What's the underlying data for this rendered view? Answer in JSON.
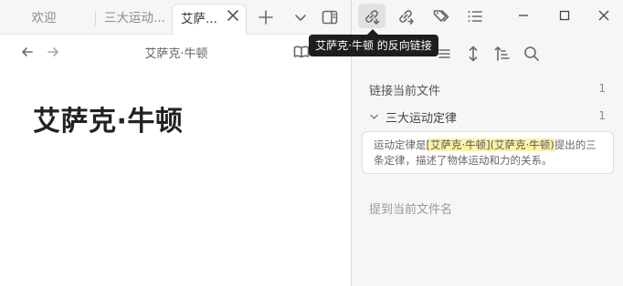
{
  "tabs": [
    {
      "label": "欢迎",
      "active": false
    },
    {
      "label": "三大运动...",
      "active": false
    },
    {
      "label": "艾萨...",
      "active": true
    }
  ],
  "view": {
    "title": "艾萨克·牛顿"
  },
  "document": {
    "title": "艾萨克·牛顿"
  },
  "tooltip": {
    "text": "艾萨克·牛顿 的反向链接"
  },
  "backlinks": {
    "linked_label": "链接当前文件",
    "linked_count": "1",
    "file": {
      "name": "三大运动定律",
      "count": "1"
    },
    "snippet": {
      "prefix": "运动定律是",
      "link1": "[艾萨克·牛顿]",
      "link2": "(艾萨克·牛顿)",
      "suffix": "提出的三条定律，描述了物体运动和力的关系。"
    },
    "unlinked_label": "提到当前文件名"
  },
  "icons": {
    "tab_close": "close-icon",
    "new_tab": "plus-icon",
    "tab_list": "chevron-down-icon",
    "sidebar_toggle": "sidebar-toggle-icon",
    "back": "arrow-left-icon",
    "forward": "arrow-right-icon",
    "reading_mode": "book-open-icon",
    "backlinks": "backlink-icon",
    "outgoing_links": "outgoing-link-icon",
    "tags": "tags-icon",
    "outline": "list-icon",
    "collapse_results": "collapse-lines-icon",
    "expand": "expand-vertical-icon",
    "sort": "sort-icon",
    "search": "search-icon",
    "minimize": "minimize-icon",
    "maximize": "maximize-icon",
    "close": "close-icon"
  }
}
